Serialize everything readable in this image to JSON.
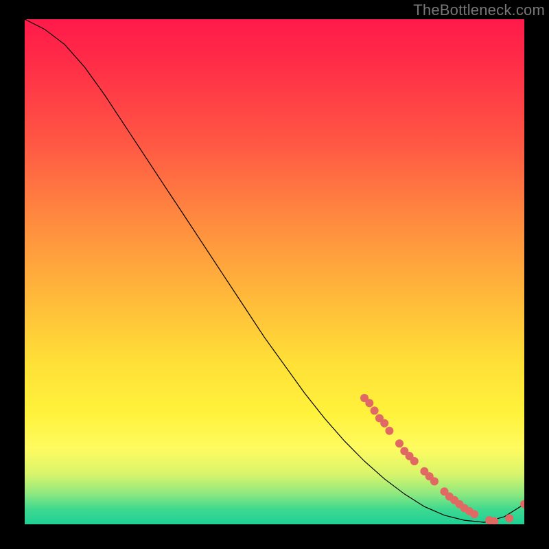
{
  "watermark": "TheBottleneck.com",
  "colors": {
    "gradient_top": "#ff1a4b",
    "gradient_mid1": "#ff8b3f",
    "gradient_mid2": "#ffe037",
    "gradient_bottom": "#1fd096",
    "marker": "#e06a63",
    "line": "#000000",
    "background": "#000000"
  },
  "chart_data": {
    "type": "line",
    "title": "",
    "xlabel": "",
    "ylabel": "",
    "xlim": [
      0,
      100
    ],
    "ylim": [
      0,
      100
    ],
    "grid": false,
    "legend": false,
    "series": [
      {
        "name": "curve",
        "x": [
          0,
          4,
          8,
          12,
          16,
          20,
          24,
          28,
          32,
          36,
          40,
          44,
          48,
          52,
          56,
          60,
          64,
          68,
          72,
          76,
          80,
          84,
          88,
          92,
          96,
          100
        ],
        "y": [
          100,
          98,
          95,
          90.5,
          85,
          79,
          73,
          67,
          61,
          55,
          49,
          43,
          37,
          31.5,
          26,
          21,
          16.5,
          12.5,
          9,
          6,
          3.5,
          1.8,
          0.8,
          0.4,
          1.5,
          4.0
        ]
      }
    ],
    "markers": {
      "name": "highlight-points",
      "x": [
        68,
        69,
        70,
        71,
        72,
        73,
        75,
        76,
        77,
        78,
        80,
        81,
        82,
        84,
        85,
        86,
        87,
        88,
        89,
        90,
        93,
        94,
        97,
        100
      ],
      "y": [
        25,
        24,
        22.5,
        21,
        20,
        18.5,
        16,
        14.5,
        13.5,
        12.5,
        10.5,
        9.5,
        8.5,
        6.5,
        5.5,
        4.8,
        4.0,
        3.2,
        2.6,
        2.0,
        0.8,
        0.6,
        1.2,
        4.0
      ]
    }
  }
}
